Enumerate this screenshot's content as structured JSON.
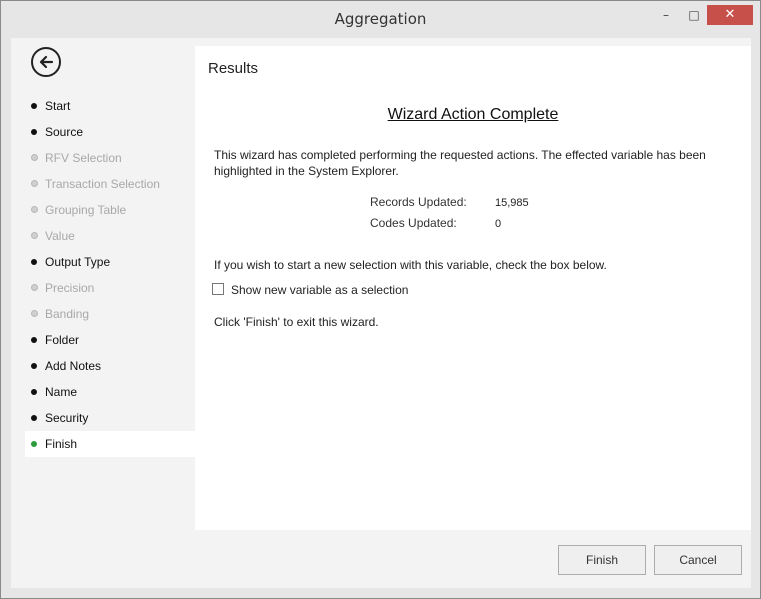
{
  "window": {
    "title": "Aggregation",
    "minimize": "–",
    "maximize": "□",
    "close": "✕"
  },
  "sidebar": {
    "back_icon": "back-arrow-icon",
    "steps": [
      {
        "label": "Start",
        "state": "done"
      },
      {
        "label": "Source",
        "state": "done"
      },
      {
        "label": "RFV Selection",
        "state": "skipped"
      },
      {
        "label": "Transaction Selection",
        "state": "skipped"
      },
      {
        "label": "Grouping Table",
        "state": "skipped"
      },
      {
        "label": "Value",
        "state": "skipped"
      },
      {
        "label": "Output Type",
        "state": "done"
      },
      {
        "label": "Precision",
        "state": "skipped"
      },
      {
        "label": "Banding",
        "state": "skipped"
      },
      {
        "label": "Folder",
        "state": "done"
      },
      {
        "label": "Add Notes",
        "state": "done"
      },
      {
        "label": "Name",
        "state": "done"
      },
      {
        "label": "Security",
        "state": "done"
      },
      {
        "label": "Finish",
        "state": "current"
      }
    ]
  },
  "main": {
    "section_title": "Results",
    "heading": "Wizard Action Complete",
    "description": "This wizard has completed performing the requested actions. The effected variable has been highlighted in the System Explorer.",
    "records_label": "Records Updated:",
    "records_value": "15,985",
    "codes_label": "Codes Updated:",
    "codes_value": "0",
    "prompt": "If you wish to start a new selection with this variable, check the box below.",
    "checkbox_label": "Show new variable as a selection",
    "checkbox_checked": false,
    "exit_text": "Click 'Finish' to exit this wizard."
  },
  "buttons": {
    "finish": "Finish",
    "cancel": "Cancel"
  },
  "colors": {
    "current_step": "#2e9b3a",
    "close_button": "#c7504a"
  }
}
